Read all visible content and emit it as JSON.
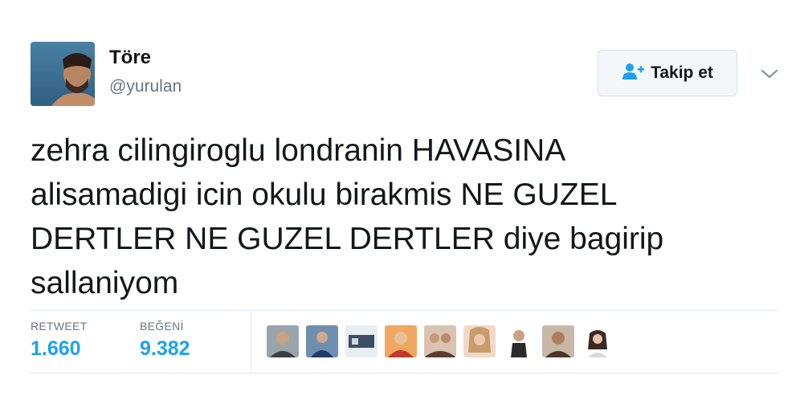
{
  "author": {
    "name": "Töre",
    "handle": "@yurulan"
  },
  "follow_button": {
    "label": "Takip et",
    "icon": "add-user-icon"
  },
  "more_menu": {
    "icon": "chevron-down-icon"
  },
  "tweet": {
    "lines": [
      "zehra cilingiroglu londranin HAVASINA",
      "alisamadigi icin okulu birakmis NE GUZEL",
      "DERTLER NE GUZEL DERTLER diye bagirip",
      "sallaniyom"
    ]
  },
  "stats": {
    "retweets": {
      "label": "RETWEET",
      "value": "1.660"
    },
    "likes": {
      "label": "BEĞENİ",
      "value": "9.382"
    }
  },
  "likers": {
    "count_shown": 9
  },
  "colors": {
    "accent": "#1da1f2",
    "secondary_text": "#657786",
    "border": "#e1e8ed",
    "text": "#14171a"
  }
}
